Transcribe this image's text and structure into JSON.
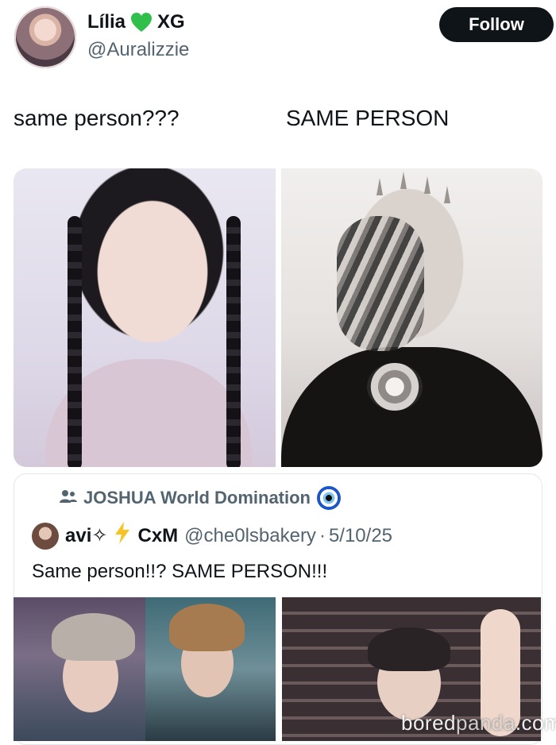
{
  "tweet": {
    "author_name_first": "Lília",
    "author_name_second": "XG",
    "author_handle": "@Auralizzie",
    "follow_label": "Follow",
    "caption_left": "same person???",
    "caption_right": "SAME PERSON"
  },
  "quote": {
    "social_context": "JOSHUA World Domination",
    "author_name_first": "avi✧",
    "author_name_second": "CxM",
    "author_handle": "@che0lsbakery",
    "separator": "·",
    "date": "5/10/25",
    "text": "Same person!!? SAME PERSON!!!"
  },
  "watermark": {
    "part1": "bored",
    "part2": "panda",
    "part3": ".com"
  },
  "colors": {
    "accent_green": "#2fbf4a",
    "text_primary": "#0f1419",
    "text_secondary": "#536471",
    "follow_bg": "#0f1419"
  }
}
